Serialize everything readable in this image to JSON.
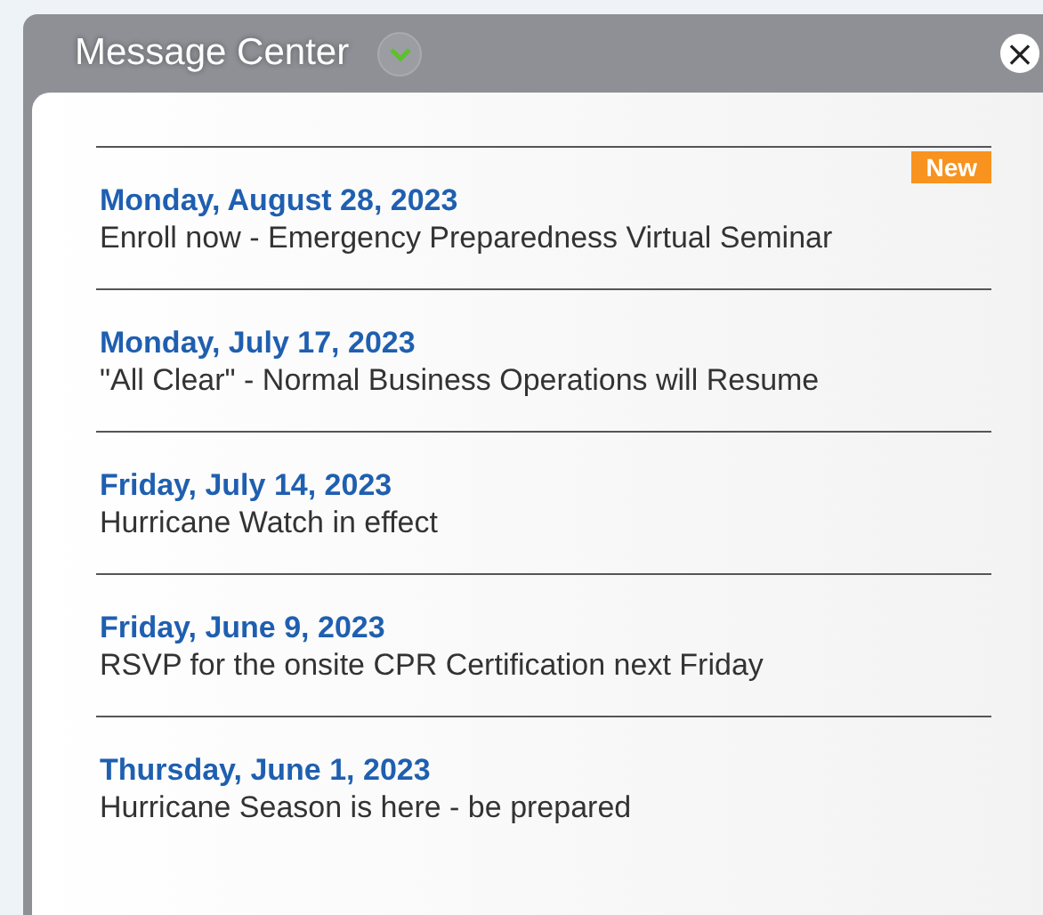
{
  "panel": {
    "title": "Message Center",
    "close": "×"
  },
  "messages": [
    {
      "date": "Monday, August 28, 2023",
      "text": "Enroll now - Emergency Preparedness Virtual Seminar",
      "badge": "New"
    },
    {
      "date": "Monday, July 17, 2023",
      "text": "\"All Clear\" - Normal Business Operations will Resume"
    },
    {
      "date": "Friday, July 14, 2023",
      "text": "Hurricane Watch in effect"
    },
    {
      "date": "Friday, June 9, 2023",
      "text": "RSVP for the onsite CPR Certification next Friday"
    },
    {
      "date": "Thursday, June 1, 2023",
      "text": "Hurricane Season is here - be prepared"
    }
  ]
}
